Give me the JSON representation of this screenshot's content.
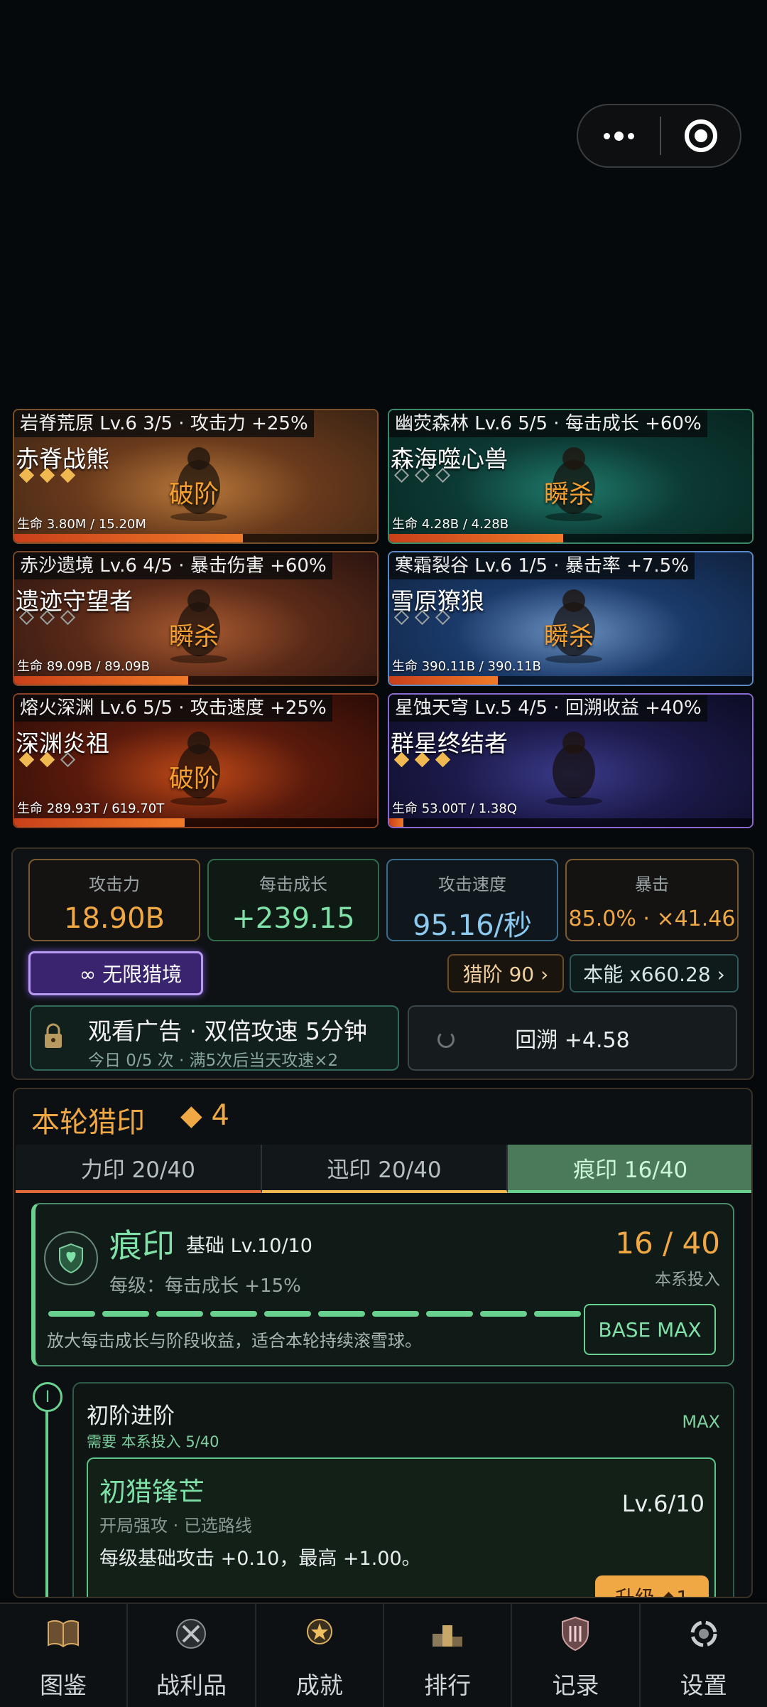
{
  "capsule": {
    "menu_icon": "more-dots-icon",
    "close_icon": "target-circle-icon"
  },
  "maps": [
    {
      "header": "岩脊荒原  Lv.6  3/5 · 攻击力 +25%",
      "boss": "赤脊战熊",
      "pips": [
        true,
        true,
        true
      ],
      "state": "破阶",
      "hp": "生命 3.80M / 15.20M",
      "hp_fraction": 0.63,
      "colors": [
        "#6a3a1c",
        "#b8793a",
        "#3a2414"
      ]
    },
    {
      "header": "幽荧森林  Lv.6  5/5 · 每击成长 +60%",
      "boss": "森海噬心兽",
      "pips": [
        false,
        false,
        false
      ],
      "state": "瞬杀",
      "hp": "生命 4.28B / 4.28B",
      "hp_fraction": 0.48,
      "colors": [
        "#0c3a34",
        "#1f7a6a",
        "#082420"
      ]
    },
    {
      "header": "赤沙遗境  Lv.6  4/5 · 暴击伤害 +60%",
      "boss": "遗迹守望者",
      "pips": [
        false,
        false,
        false
      ],
      "state": "瞬杀",
      "hp": "生命 89.09B / 89.09B",
      "hp_fraction": 0.48,
      "colors": [
        "#5a2a18",
        "#a85a30",
        "#2a1410"
      ]
    },
    {
      "header": "寒霜裂谷  Lv.6  1/5 · 暴击率 +7.5%",
      "boss": "雪原獠狼",
      "pips": [
        false,
        false,
        false
      ],
      "state": "瞬杀",
      "hp": "生命 390.11B / 390.11B",
      "hp_fraction": 0.3,
      "colors": [
        "#1a3a6a",
        "#6a90c0",
        "#10223e"
      ]
    },
    {
      "header": "熔火深渊  Lv.6  5/5 · 攻击速度 +25%",
      "boss": "深渊炎祖",
      "pips": [
        true,
        true,
        false
      ],
      "state": "破阶",
      "hp": "生命 289.93T / 619.70T",
      "hp_fraction": 0.47,
      "colors": [
        "#5a1a0c",
        "#c04a18",
        "#2a0c06"
      ]
    },
    {
      "header": "星蚀天穹  Lv.5  4/5 · 回溯收益 +40%",
      "boss": "群星终结者",
      "pips": [
        true,
        true,
        true
      ],
      "state": "",
      "hp": "生命 53.00T / 1.38Q",
      "hp_fraction": 0.04,
      "colors": [
        "#1c1a4a",
        "#3a3a8a",
        "#0c0c24"
      ]
    }
  ],
  "stats": [
    {
      "label": "攻击力",
      "value": "18.90B",
      "color": "#f0a844",
      "border": "#7a5a30"
    },
    {
      "label": "每击成长",
      "value": "+239.15",
      "color": "#7fe0a8",
      "border": "#2f6a4a"
    },
    {
      "label": "攻击速度",
      "value": "95.16/秒",
      "color": "#8ccaf0",
      "border": "#3a6a8a"
    },
    {
      "label": "暴击",
      "value": "85.0% · ×41.46",
      "color": "#f0a844",
      "border": "#7a5a30"
    }
  ],
  "infinite_hunt": {
    "icon": "",
    "label": "∞ 无限猎境"
  },
  "hunt_rank": "猎阶 90 ›",
  "instinct": "本能 x660.28 ›",
  "ad": {
    "title": "观看广告 · 双倍攻速 5分钟",
    "subtitle": "今日 0/5 次 · 满5次后当天攻速×2"
  },
  "rewind": "回溯 +4.58",
  "seal": {
    "title": "本轮猎印",
    "points": "◆ 4",
    "tabs": [
      {
        "label": "力印 20/40",
        "active": false,
        "underline": "#e06a3a"
      },
      {
        "label": "迅印 20/40",
        "active": false,
        "underline": "#f0b850"
      },
      {
        "label": "痕印 16/40",
        "active": true,
        "underline": "#6ad090"
      }
    ],
    "name": "痕印",
    "level": "基础 Lv.10/10",
    "per_level": "每级：每击成长 +15%",
    "invest": "16 / 40",
    "invest_label": "本系投入",
    "desc": "放大每击成长与阶段收益，适合本轮持续滚雪球。",
    "progress_segments": 10,
    "base_max": "BASE MAX",
    "stage": {
      "node": "I",
      "title": "初阶进阶",
      "need": "需要 本系投入 5/40",
      "max": "MAX"
    },
    "perk": {
      "title": "初猎锋芒",
      "tags": "开局强攻 · 已选路线",
      "level": "Lv.6/10",
      "desc": "每级基础攻击 +0.10，最高 +1.00。",
      "upgrade": "升级  ◆1"
    }
  },
  "nav": [
    {
      "label": "图鉴",
      "icon": "book-icon"
    },
    {
      "label": "战利品",
      "icon": "trophy-loot-icon"
    },
    {
      "label": "成就",
      "icon": "medal-icon"
    },
    {
      "label": "排行",
      "icon": "podium-icon"
    },
    {
      "label": "记录",
      "icon": "shield-record-icon"
    },
    {
      "label": "设置",
      "icon": "settings-icon"
    }
  ]
}
